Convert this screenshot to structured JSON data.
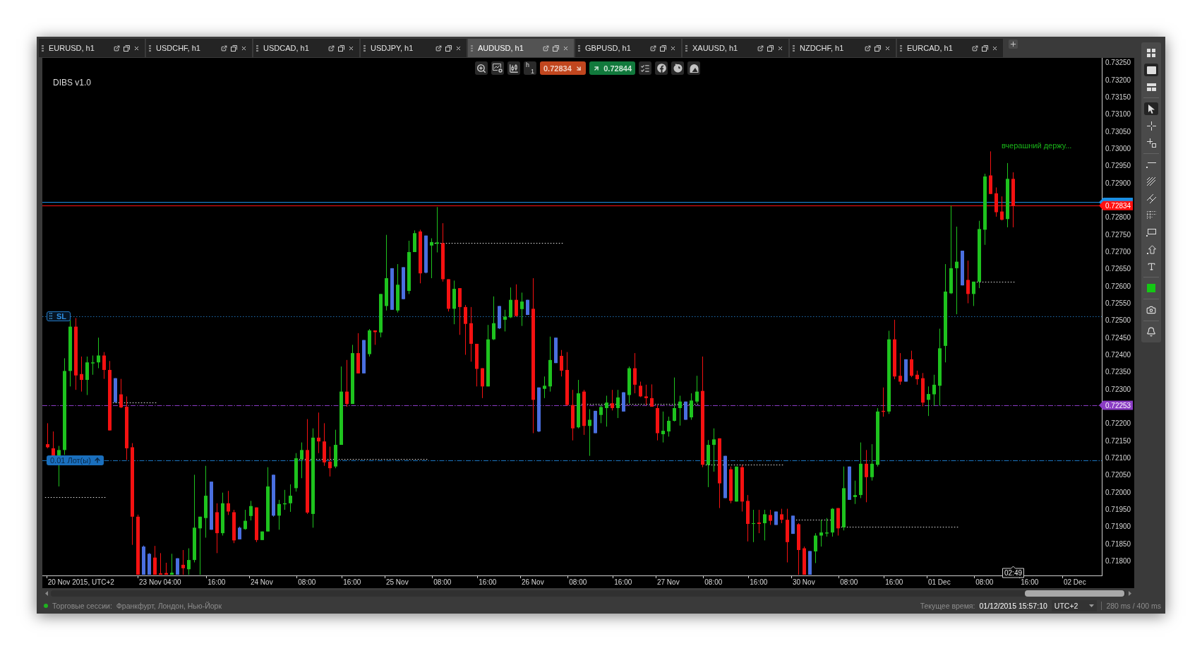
{
  "tabs": [
    {
      "label": "EURUSD, h1",
      "selected": false
    },
    {
      "label": "USDCHF, h1",
      "selected": false
    },
    {
      "label": "USDCAD, h1",
      "selected": false
    },
    {
      "label": "USDJPY, h1",
      "selected": false
    },
    {
      "label": "AUDUSD, h1",
      "selected": true
    },
    {
      "label": "GBPUSD, h1",
      "selected": false
    },
    {
      "label": "XAUUSD, h1",
      "selected": false
    },
    {
      "label": "NZDCHF, h1",
      "selected": false
    },
    {
      "label": "EURCAD, h1",
      "selected": false
    }
  ],
  "chart": {
    "indicator_label": "DIBS v1.0",
    "toolbar": {
      "timeframe": {
        "unit": "h",
        "count": "1"
      },
      "sell_price": "0.72834",
      "buy_price": "0.72844"
    },
    "order_tags": [
      {
        "kind": "stop_loss",
        "label": "SL"
      },
      {
        "kind": "order",
        "label": "0.01 Лот(ы)"
      }
    ],
    "candle_timer": "02:49",
    "chart_data": {
      "type": "candlestick",
      "categories": [
        null,
        null,
        null,
        null,
        null,
        null,
        "20 Nov 2015, UTC+2",
        null,
        null,
        null,
        null,
        null,
        null,
        null,
        null,
        null,
        null,
        null,
        null,
        null,
        "23 Nov 04:00",
        null,
        null,
        null,
        null,
        null,
        null,
        null,
        null,
        null,
        "16:00",
        null,
        null,
        null,
        null,
        null,
        null,
        null,
        "24 Nov",
        null,
        null,
        null,
        null,
        null,
        null,
        null,
        "08:00",
        null,
        null,
        null,
        null,
        null,
        null,
        null,
        "16:00",
        null,
        null,
        null,
        null,
        null,
        null,
        null,
        "25 Nov",
        null,
        null,
        null,
        null,
        null,
        null,
        null,
        "08:00",
        null,
        null,
        null,
        null,
        null,
        null,
        null,
        "16:00",
        null,
        null,
        null,
        null,
        null,
        null,
        null,
        "26 Nov",
        null,
        null,
        null,
        null,
        null,
        null,
        null,
        "08:00",
        null,
        null,
        null,
        null,
        null,
        null,
        null,
        "16:00",
        null,
        null,
        null,
        null,
        null,
        null,
        null,
        "27 Nov",
        null,
        null,
        null,
        null,
        null,
        null,
        null,
        "08:00",
        null,
        null,
        null,
        null,
        null,
        null,
        null,
        "16:00",
        null,
        null,
        null,
        null,
        null,
        null,
        null,
        "30 Nov",
        null,
        null,
        null,
        null,
        null,
        null,
        null,
        "08:00",
        null,
        null,
        null,
        null,
        null,
        null,
        null,
        "16:00",
        null,
        null,
        null,
        null,
        null,
        null,
        null,
        "01 Dec",
        null,
        null,
        null,
        null,
        null,
        null,
        null,
        "08:00",
        null,
        null,
        null,
        null,
        null,
        null,
        null,
        "16:00",
        null,
        null,
        null,
        null,
        null,
        null,
        null,
        "02 Dec",
        null,
        null,
        null,
        null
      ],
      "ohlc": [
        [
          0.7214,
          0.72201,
          0.72128,
          0.72131
        ],
        [
          0.72128,
          0.72177,
          0.72104,
          0.72106
        ],
        [
          0.72106,
          0.72135,
          0.72017,
          0.72123
        ],
        [
          0.72123,
          0.7239,
          0.72109,
          0.72353
        ],
        [
          0.72353,
          0.72502,
          0.72308,
          0.72482
        ],
        [
          0.72482,
          0.72507,
          0.72298,
          0.7234
        ],
        [
          0.72344,
          0.72395,
          0.72293,
          0.72327
        ],
        [
          0.72327,
          0.72395,
          0.72283,
          0.72378
        ],
        [
          0.72375,
          0.72398,
          0.72342,
          0.72378
        ],
        [
          0.72378,
          0.7245,
          0.72361,
          0.72398
        ],
        [
          0.72398,
          0.72408,
          0.7233,
          0.72356
        ],
        [
          0.72356,
          0.72382,
          0.7218,
          0.7218
        ],
        [
          0.72332,
          0.72332,
          0.72262,
          0.72262
        ],
        [
          0.72285,
          0.7233,
          0.72245,
          0.72247
        ],
        [
          0.72249,
          0.72279,
          0.72094,
          0.72128
        ],
        [
          0.72131,
          0.72143,
          0.71847,
          0.71929
        ],
        [
          0.71929,
          0.71935,
          0.7176,
          0.7176
        ],
        [
          0.71842,
          0.71845,
          0.7176,
          0.7176
        ],
        [
          0.71821,
          0.71823,
          0.7176,
          0.7176
        ],
        [
          0.7181,
          0.71844,
          0.7176,
          0.7176
        ],
        [
          0.71764,
          0.71823,
          0.7176,
          0.7176
        ],
        [
          0.71765,
          0.71795,
          0.7176,
          0.7176
        ],
        [
          0.7176,
          0.71821,
          0.7176,
          0.71766
        ],
        [
          0.71808,
          0.71808,
          0.7176,
          0.7176
        ],
        [
          0.71789,
          0.71832,
          0.7176,
          0.71779
        ],
        [
          0.71776,
          0.71837,
          0.7176,
          0.71803
        ],
        [
          0.71803,
          0.72051,
          0.71796,
          0.71897
        ],
        [
          0.71895,
          0.71929,
          0.7176,
          0.71929
        ],
        [
          0.71925,
          0.72077,
          0.71868,
          0.7199
        ],
        [
          0.72031,
          0.72031,
          0.71891,
          0.71891
        ],
        [
          0.71942,
          0.71968,
          0.71823,
          0.71881
        ],
        [
          0.71881,
          0.71999,
          0.71874,
          0.71968
        ],
        [
          0.71968,
          0.72004,
          0.71934,
          0.71944
        ],
        [
          0.71942,
          0.71949,
          0.71852,
          0.7186
        ],
        [
          0.71897,
          0.719,
          0.71863,
          0.71863
        ],
        [
          0.71893,
          0.71949,
          0.71891,
          0.71917
        ],
        [
          0.71931,
          0.71975,
          0.71918,
          0.7196
        ],
        [
          0.71956,
          0.71956,
          0.71855,
          0.71861
        ],
        [
          0.71861,
          0.71886,
          0.71861,
          0.71886
        ],
        [
          0.71886,
          0.72073,
          0.71886,
          0.72017
        ],
        [
          0.72051,
          0.72051,
          0.71929,
          0.71932
        ],
        [
          0.71932,
          0.71978,
          0.71891,
          0.71966
        ],
        [
          0.71965,
          0.72007,
          0.71949,
          0.71968
        ],
        [
          0.71968,
          0.72023,
          0.71943,
          0.7199
        ],
        [
          0.72012,
          0.72114,
          0.72002,
          0.72099
        ],
        [
          0.72096,
          0.72145,
          0.72041,
          0.72123
        ],
        [
          0.72123,
          0.72213,
          0.71937,
          0.71941
        ],
        [
          0.71937,
          0.72186,
          0.71897,
          0.72159
        ],
        [
          0.72159,
          0.72232,
          0.72114,
          0.72148
        ],
        [
          0.72148,
          0.72201,
          0.72077,
          0.72087
        ],
        [
          0.72089,
          0.72133,
          0.72046,
          0.7207
        ],
        [
          0.72075,
          0.72182,
          0.7207,
          0.72138
        ],
        [
          0.72138,
          0.72366,
          0.72138,
          0.72293
        ],
        [
          0.72293,
          0.72385,
          0.72249,
          0.72257
        ],
        [
          0.72257,
          0.72429,
          0.72257,
          0.72405
        ],
        [
          0.72405,
          0.72463,
          0.72346,
          0.72346
        ],
        [
          0.72443,
          0.72443,
          0.72346,
          0.72346
        ],
        [
          0.72402,
          0.72475,
          0.72395,
          0.72471
        ],
        [
          0.72471,
          0.72471,
          0.72429,
          0.72466
        ],
        [
          0.72465,
          0.72577,
          0.72451,
          0.72577
        ],
        [
          0.72542,
          0.72749,
          0.72529,
          0.72623
        ],
        [
          0.72652,
          0.72652,
          0.72531,
          0.72531
        ],
        [
          0.72529,
          0.72664,
          0.72523,
          0.72604
        ],
        [
          0.72655,
          0.72655,
          0.72562,
          0.72562
        ],
        [
          0.72586,
          0.72732,
          0.72577,
          0.72699
        ],
        [
          0.72699,
          0.72762,
          0.72699,
          0.72754
        ],
        [
          0.72759,
          0.72764,
          0.72608,
          0.72637
        ],
        [
          0.72747,
          0.72747,
          0.72637,
          0.72639
        ],
        [
          0.72718,
          0.72739,
          0.72623,
          0.72728
        ],
        [
          0.72723,
          0.7283,
          0.72698,
          0.72727
        ],
        [
          0.72725,
          0.72783,
          0.72613,
          0.7262
        ],
        [
          0.7262,
          0.7262,
          0.72526,
          0.72534
        ],
        [
          0.72534,
          0.72616,
          0.72489,
          0.72592
        ],
        [
          0.72594,
          0.72594,
          0.72458,
          0.72539
        ],
        [
          0.72539,
          0.72545,
          0.724,
          0.7249
        ],
        [
          0.72492,
          0.72539,
          0.7238,
          0.72432
        ],
        [
          0.72432,
          0.72432,
          0.72308,
          0.72359
        ],
        [
          0.72361,
          0.72361,
          0.72274,
          0.72308
        ],
        [
          0.72308,
          0.72487,
          0.72308,
          0.72445
        ],
        [
          0.72445,
          0.7257,
          0.72443,
          0.72492
        ],
        [
          0.72542,
          0.72542,
          0.72475,
          0.72477
        ],
        [
          0.72502,
          0.72531,
          0.72468,
          0.72511
        ],
        [
          0.72509,
          0.72596,
          0.72507,
          0.7256
        ],
        [
          0.7256,
          0.72605,
          0.72511,
          0.72513
        ],
        [
          0.72533,
          0.72581,
          0.72484,
          0.72555
        ],
        [
          0.7256,
          0.7256,
          0.72516,
          0.72516
        ],
        [
          0.72534,
          0.72623,
          0.72172,
          0.72269
        ],
        [
          0.72305,
          0.72305,
          0.72175,
          0.72177
        ],
        [
          0.72301,
          0.72337,
          0.72274,
          0.7231
        ],
        [
          0.72308,
          0.72453,
          0.72293,
          0.72385
        ],
        [
          0.7245,
          0.7245,
          0.72376,
          0.72376
        ],
        [
          0.72397,
          0.72414,
          0.72337,
          0.72354
        ],
        [
          0.72356,
          0.72408,
          0.72252,
          0.72254
        ],
        [
          0.72254,
          0.72298,
          0.72151,
          0.72186
        ],
        [
          0.72189,
          0.72327,
          0.72186,
          0.72288
        ],
        [
          0.72293,
          0.72298,
          0.72167,
          0.72193
        ],
        [
          0.72193,
          0.72242,
          0.72106,
          0.72211
        ],
        [
          0.72237,
          0.72237,
          0.72172,
          0.72172
        ],
        [
          0.72225,
          0.72254,
          0.72201,
          0.72248
        ],
        [
          0.72245,
          0.72281,
          0.72191,
          0.72261
        ],
        [
          0.72259,
          0.72298,
          0.72238,
          0.72245
        ],
        [
          0.72245,
          0.72298,
          0.72216,
          0.72276
        ],
        [
          0.72291,
          0.72291,
          0.72235,
          0.72235
        ],
        [
          0.72283,
          0.72366,
          0.72259,
          0.72361
        ],
        [
          0.72361,
          0.72405,
          0.72288,
          0.72313
        ],
        [
          0.7231,
          0.72322,
          0.72277,
          0.72279
        ],
        [
          0.72279,
          0.72313,
          0.72254,
          0.72274
        ],
        [
          0.72274,
          0.72314,
          0.72249,
          0.72249
        ],
        [
          0.72245,
          0.72254,
          0.72151,
          0.72172
        ],
        [
          0.72169,
          0.72235,
          0.72145,
          0.72179
        ],
        [
          0.72177,
          0.7222,
          0.72162,
          0.72208
        ],
        [
          0.72208,
          0.72334,
          0.72206,
          0.72245
        ],
        [
          0.72245,
          0.72281,
          0.72194,
          0.72264
        ],
        [
          0.72264,
          0.72264,
          0.72211,
          0.72211
        ],
        [
          0.72218,
          0.72288,
          0.72211,
          0.72267
        ],
        [
          0.72264,
          0.72339,
          0.72259,
          0.72293
        ],
        [
          0.72295,
          0.72395,
          0.72073,
          0.7208
        ],
        [
          0.7208,
          0.72152,
          0.72015,
          0.72138
        ],
        [
          0.72138,
          0.72186,
          0.7206,
          0.72154
        ],
        [
          0.72157,
          0.72157,
          0.71954,
          0.72026
        ],
        [
          0.72106,
          0.72106,
          0.71983,
          0.71983
        ],
        [
          0.72067,
          0.72075,
          0.71968,
          0.71975
        ],
        [
          0.71973,
          0.72075,
          0.71973,
          0.72075
        ],
        [
          0.72073,
          0.7208,
          0.71944,
          0.71973
        ],
        [
          0.71975,
          0.71992,
          0.71857,
          0.71908
        ],
        [
          0.71908,
          0.71949,
          0.71855,
          0.7191
        ],
        [
          0.71912,
          0.71949,
          0.71881,
          0.71908
        ],
        [
          0.7191,
          0.71949,
          0.7186,
          0.71936
        ],
        [
          0.71934,
          0.71949,
          0.71905,
          0.71917
        ],
        [
          0.71944,
          0.71944,
          0.71905,
          0.71905
        ],
        [
          0.71936,
          0.71952,
          0.7191,
          0.7192
        ],
        [
          0.7192,
          0.71952,
          0.71796,
          0.71855
        ],
        [
          0.71932,
          0.71932,
          0.71879,
          0.71879
        ],
        [
          0.71907,
          0.7191,
          0.7176,
          0.71832
        ],
        [
          0.71837,
          0.71842,
          0.7176,
          0.7176
        ],
        [
          0.71829,
          0.71829,
          0.7176,
          0.7176
        ],
        [
          0.71828,
          0.71881,
          0.71794,
          0.71874
        ],
        [
          0.71874,
          0.7192,
          0.71842,
          0.71883
        ],
        [
          0.7188,
          0.71925,
          0.71871,
          0.71883
        ],
        [
          0.71883,
          0.71954,
          0.71871,
          0.71952
        ],
        [
          0.71954,
          0.71954,
          0.71874,
          0.71895
        ],
        [
          0.71898,
          0.72075,
          0.71889,
          0.72012
        ],
        [
          0.72075,
          0.72075,
          0.71978,
          0.71978
        ],
        [
          0.71986,
          0.72034,
          0.71966,
          0.71992
        ],
        [
          0.71992,
          0.72145,
          0.71983,
          0.72083
        ],
        [
          0.72083,
          0.72123,
          0.71971,
          0.72044
        ],
        [
          0.72044,
          0.7214,
          0.72034,
          0.72083
        ],
        [
          0.7208,
          0.72245,
          0.72075,
          0.72235
        ],
        [
          0.72237,
          0.72305,
          0.7222,
          0.72234
        ],
        [
          0.72235,
          0.7247,
          0.72228,
          0.72445
        ],
        [
          0.72445,
          0.72502,
          0.72329,
          0.72337
        ],
        [
          0.72339,
          0.72405,
          0.72313,
          0.72322
        ],
        [
          0.72387,
          0.72387,
          0.72322,
          0.72322
        ],
        [
          0.72387,
          0.72412,
          0.72335,
          0.72339
        ],
        [
          0.72342,
          0.72354,
          0.72313,
          0.72329
        ],
        [
          0.72332,
          0.72347,
          0.7225,
          0.72261
        ],
        [
          0.72269,
          0.72308,
          0.72222,
          0.72286
        ],
        [
          0.72285,
          0.72342,
          0.72252,
          0.72313
        ],
        [
          0.7231,
          0.72476,
          0.72252,
          0.72419
        ],
        [
          0.72426,
          0.72664,
          0.72378,
          0.72584
        ],
        [
          0.72579,
          0.72834,
          0.72577,
          0.72652
        ],
        [
          0.72652,
          0.72773,
          0.72518,
          0.72671
        ],
        [
          0.72703,
          0.72703,
          0.72602,
          0.72602
        ],
        [
          0.72618,
          0.72674,
          0.7255,
          0.72577
        ],
        [
          0.72577,
          0.72613,
          0.72542,
          0.72613
        ],
        [
          0.72613,
          0.7279,
          0.72594,
          0.72766
        ],
        [
          0.72764,
          0.72927,
          0.7272,
          0.72919
        ],
        [
          0.72922,
          0.72992,
          0.72868,
          0.72868
        ],
        [
          0.7287,
          0.72887,
          0.72802,
          0.72815
        ],
        [
          0.72817,
          0.72861,
          0.72791,
          0.72793
        ],
        [
          0.72795,
          0.72958,
          0.72771,
          0.72912
        ],
        [
          0.72912,
          0.72931,
          0.72771,
          0.72834
        ],
        null,
        null,
        null,
        null,
        null,
        null,
        null,
        null,
        null,
        null,
        null,
        null,
        null,
        null,
        null
      ],
      "colors": [
        "#f51111",
        "#f51111",
        "#1ec31e",
        "#1ec31e",
        "#1ec31e",
        "#f51111",
        "#f51111",
        "#1ec31e",
        "#1ec31e",
        "#1ec31e",
        "#f51111",
        "#f51111",
        "#4a6fe0",
        "#f51111",
        "#f51111",
        "#f51111",
        "#f51111",
        "#4a6fe0",
        "#4a6fe0",
        "#f51111",
        "#f51111",
        "#f51111",
        "#1ec31e",
        "#4a6fe0",
        "#f51111",
        "#1ec31e",
        "#1ec31e",
        "#1ec31e",
        "#1ec31e",
        "#4a6fe0",
        "#f51111",
        "#1ec31e",
        "#f51111",
        "#f51111",
        "#4a6fe0",
        "#1ec31e",
        "#1ec31e",
        "#f51111",
        "#1ec31e",
        "#1ec31e",
        "#4a6fe0",
        "#1ec31e",
        "#1ec31e",
        "#1ec31e",
        "#1ec31e",
        "#1ec31e",
        "#f51111",
        "#1ec31e",
        "#f51111",
        "#f51111",
        "#f51111",
        "#1ec31e",
        "#1ec31e",
        "#f51111",
        "#1ec31e",
        "#f51111",
        "#4a6fe0",
        "#1ec31e",
        "#f51111",
        "#1ec31e",
        "#1ec31e",
        "#4a6fe0",
        "#1ec31e",
        "#4a6fe0",
        "#1ec31e",
        "#1ec31e",
        "#f51111",
        "#4a6fe0",
        "#1ec31e",
        "#1ec31e",
        "#f51111",
        "#f51111",
        "#1ec31e",
        "#f51111",
        "#f51111",
        "#f51111",
        "#f51111",
        "#f51111",
        "#1ec31e",
        "#1ec31e",
        "#4a6fe0",
        "#1ec31e",
        "#1ec31e",
        "#f51111",
        "#1ec31e",
        "#4a6fe0",
        "#f51111",
        "#4a6fe0",
        "#1ec31e",
        "#1ec31e",
        "#4a6fe0",
        "#f51111",
        "#f51111",
        "#f51111",
        "#1ec31e",
        "#f51111",
        "#1ec31e",
        "#4a6fe0",
        "#1ec31e",
        "#1ec31e",
        "#f51111",
        "#1ec31e",
        "#4a6fe0",
        "#1ec31e",
        "#f51111",
        "#f51111",
        "#f51111",
        "#f51111",
        "#f51111",
        "#1ec31e",
        "#1ec31e",
        "#1ec31e",
        "#1ec31e",
        "#4a6fe0",
        "#1ec31e",
        "#1ec31e",
        "#f51111",
        "#1ec31e",
        "#1ec31e",
        "#f51111",
        "#4a6fe0",
        "#f51111",
        "#1ec31e",
        "#f51111",
        "#f51111",
        "#1ec31e",
        "#f51111",
        "#1ec31e",
        "#f51111",
        "#4a6fe0",
        "#f51111",
        "#f51111",
        "#4a6fe0",
        "#f51111",
        "#f51111",
        "#4a6fe0",
        "#1ec31e",
        "#1ec31e",
        "#1ec31e",
        "#1ec31e",
        "#f51111",
        "#1ec31e",
        "#4a6fe0",
        "#1ec31e",
        "#1ec31e",
        "#f51111",
        "#1ec31e",
        "#1ec31e",
        "#f51111",
        "#1ec31e",
        "#f51111",
        "#f51111",
        "#4a6fe0",
        "#f51111",
        "#f51111",
        "#f51111",
        "#1ec31e",
        "#1ec31e",
        "#1ec31e",
        "#1ec31e",
        "#1ec31e",
        "#1ec31e",
        "#4a6fe0",
        "#f51111",
        "#1ec31e",
        "#1ec31e",
        "#1ec31e",
        "#f51111",
        "#f51111",
        "#f51111",
        "#1ec31e",
        "#f51111",
        null,
        null,
        null,
        null,
        null,
        null,
        null,
        null,
        null,
        null,
        null,
        null,
        null,
        null,
        null
      ],
      "series": [
        {
          "type": "line",
          "color": "#e6e6e6",
          "line_style": "dotted",
          "values": [
            0.71986,
            0.71986,
            0.71986,
            0.71986,
            0.71986,
            0.71986,
            0.71986,
            0.71986,
            0.71986,
            0.71986,
            0.71986,
            null,
            0.72262,
            0.72262,
            0.72262,
            0.72262,
            0.72262,
            0.72262,
            0.72262,
            0.72262,
            null,
            null,
            null,
            null,
            null,
            null,
            null,
            null,
            null,
            null,
            null,
            null,
            null,
            null,
            null,
            null,
            null,
            null,
            null,
            null,
            null,
            null,
            null,
            null,
            null,
            0.72097,
            0.72097,
            0.72097,
            0.72097,
            0.72097,
            0.72097,
            0.72097,
            0.72097,
            0.72097,
            0.72097,
            0.72097,
            0.72097,
            0.72097,
            0.72097,
            0.72097,
            0.72097,
            0.72097,
            0.72097,
            0.72097,
            0.72097,
            0.72097,
            0.72097,
            0.72097,
            null,
            0.72725,
            0.72725,
            0.72725,
            0.72725,
            0.72725,
            0.72725,
            0.72725,
            0.72725,
            0.72725,
            0.72725,
            0.72725,
            0.72725,
            0.72725,
            0.72725,
            0.72725,
            0.72725,
            0.72725,
            0.72725,
            0.72725,
            0.72725,
            0.72725,
            0.72725,
            0.72725,
            null,
            null,
            null,
            0.72257,
            0.72257,
            0.72257,
            0.72257,
            0.72257,
            0.72257,
            0.72257,
            0.72257,
            0.72257,
            0.72257,
            0.72257,
            0.72257,
            0.72257,
            0.72257,
            0.72257,
            0.72257,
            0.72257,
            0.72257,
            0.72257,
            0.72257,
            0.72257,
            null,
            0.7208,
            0.7208,
            0.7208,
            0.7208,
            0.7208,
            0.7208,
            0.7208,
            0.7208,
            0.7208,
            0.7208,
            0.7208,
            0.7208,
            0.7208,
            0.7208,
            null,
            null,
            0.7192,
            0.7192,
            0.7192,
            0.7192,
            0.7192,
            0.7192,
            0.7192,
            null,
            0.719,
            0.719,
            0.719,
            0.719,
            0.719,
            0.719,
            0.719,
            0.719,
            0.719,
            0.719,
            0.719,
            0.719,
            0.719,
            0.719,
            0.719,
            0.719,
            0.719,
            0.719,
            0.719,
            0.719,
            0.719,
            null,
            null,
            null,
            0.72613,
            0.72613,
            0.72613,
            0.72613,
            0.72613,
            0.72613,
            0.72613,
            null,
            null,
            null,
            null,
            null,
            null,
            null,
            null,
            null,
            null,
            null,
            null,
            null,
            null,
            null
          ]
        }
      ],
      "ylim": [
        0.71758,
        0.73264
      ],
      "yticks": [
        {
          "value": 0.7325,
          "label": "0.73250"
        },
        {
          "value": 0.732,
          "label": "0.73200"
        },
        {
          "value": 0.7315,
          "label": "0.73150"
        },
        {
          "value": 0.731,
          "label": "0.73100"
        },
        {
          "value": 0.7305,
          "label": "0.73050"
        },
        {
          "value": 0.73,
          "label": "0.73000"
        },
        {
          "value": 0.7295,
          "label": "0.72950"
        },
        {
          "value": 0.729,
          "label": "0.72900"
        },
        {
          "value": 0.728,
          "label": "0.72800"
        },
        {
          "value": 0.7275,
          "label": "0.72750"
        },
        {
          "value": 0.727,
          "label": "0.72700"
        },
        {
          "value": 0.7265,
          "label": "0.72650"
        },
        {
          "value": 0.726,
          "label": "0.72600"
        },
        {
          "value": 0.7255,
          "label": "0.72550"
        },
        {
          "value": 0.725,
          "label": "0.72500"
        },
        {
          "value": 0.7245,
          "label": "0.72450"
        },
        {
          "value": 0.724,
          "label": "0.72400"
        },
        {
          "value": 0.7235,
          "label": "0.72350"
        },
        {
          "value": 0.723,
          "label": "0.72300"
        },
        {
          "value": 0.722,
          "label": "0.72200"
        },
        {
          "value": 0.7215,
          "label": "0.72150"
        },
        {
          "value": 0.721,
          "label": "0.72100"
        },
        {
          "value": 0.7205,
          "label": "0.72050"
        },
        {
          "value": 0.72,
          "label": "0.72000"
        },
        {
          "value": 0.7195,
          "label": "0.71950"
        },
        {
          "value": 0.719,
          "label": "0.71900"
        },
        {
          "value": 0.7185,
          "label": "0.71850"
        },
        {
          "value": 0.718,
          "label": "0.71800"
        }
      ],
      "ref_lines": [
        {
          "axis": "y",
          "value": 0.72844,
          "color": "#1c8fe3",
          "line_style": "solid"
        },
        {
          "axis": "y",
          "value": 0.72834,
          "label": "0.72834",
          "color": "#ff1010",
          "line_style": "solid"
        },
        {
          "axis": "y",
          "value": 0.72513,
          "color": "#1f6fb2",
          "line_style": "dotted"
        },
        {
          "axis": "y",
          "value": 0.72253,
          "label": "0.72253",
          "color": "#8a3cc4",
          "line_style": "dashdot"
        },
        {
          "axis": "y",
          "value": 0.72092,
          "color": "#1a74c0",
          "line_style": "dashdot"
        }
      ],
      "annotations": [
        "вчерашний держу..."
      ]
    }
  },
  "right_toolbar": {
    "groups": [
      {
        "tools": [
          {
            "selected": false
          },
          {
            "selected": true
          },
          {
            "selected": false
          }
        ]
      },
      {
        "tools": [
          {
            "selected": true
          },
          {
            "selected": false
          },
          {
            "selected": false
          }
        ]
      },
      {
        "tools": [
          {
            "selected": false
          },
          {
            "selected": false
          },
          {
            "selected": false
          },
          {
            "selected": false
          },
          {
            "selected": false
          },
          {
            "selected": false
          },
          {
            "selected": false
          }
        ]
      },
      {
        "tools": [
          {
            "color": "#14c814"
          }
        ]
      },
      {
        "tools": [
          {
            "selected": false
          }
        ]
      },
      {
        "tools": [
          {
            "selected": false
          }
        ]
      }
    ]
  },
  "status_bar": {
    "sessions_label": "Торговые сессии:",
    "sessions": "Франкфурт, Лондон, Нью-Йорк",
    "time_label": "Текущее время:",
    "time": "01/12/2015 15:57:10",
    "timezone": "UTC+2",
    "latency": "280 ms / 400 ms"
  }
}
